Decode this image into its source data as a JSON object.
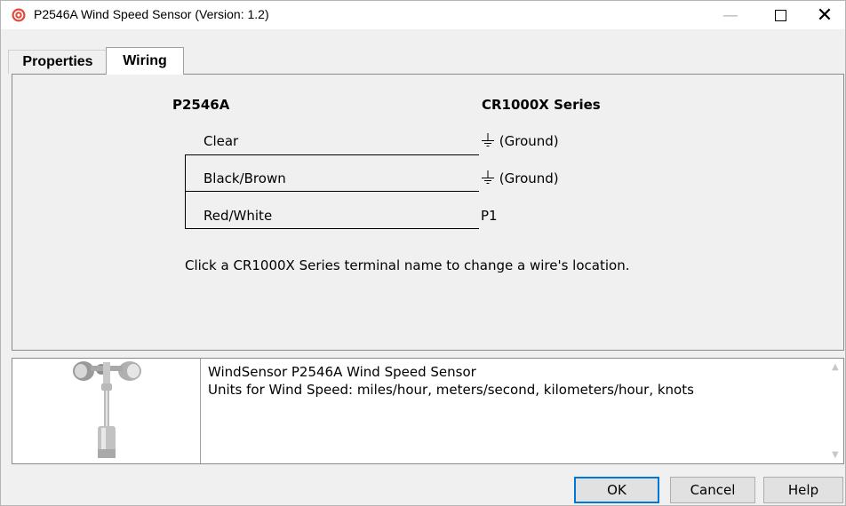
{
  "window": {
    "title": "P2546A Wind Speed Sensor (Version: 1.2)",
    "minimize_symbol": "—",
    "close_symbol": "✕"
  },
  "tabs": [
    {
      "label": "Properties",
      "selected": false
    },
    {
      "label": "Wiring",
      "selected": true
    }
  ],
  "wiring": {
    "sensor_header": "P2546A",
    "logger_header": "CR1000X Series",
    "wires": [
      {
        "name": "Clear",
        "terminal": "(Ground)",
        "terminal_icon": "ground-icon"
      },
      {
        "name": "Black/Brown",
        "terminal": "(Ground)",
        "terminal_icon": "ground-icon"
      },
      {
        "name": "Red/White",
        "terminal": "P1",
        "terminal_icon": ""
      }
    ],
    "hint": "Click a CR1000X Series terminal name to change a wire's location."
  },
  "description": {
    "line1": "WindSensor P2546A Wind Speed Sensor",
    "line2": "Units for Wind Speed: miles/hour, meters/second, kilometers/hour, knots",
    "image_icon": "anemometer-icon"
  },
  "buttons": {
    "ok": "OK",
    "cancel": "Cancel",
    "help": "Help"
  },
  "colors": {
    "app_icon": "#e04b3c",
    "focus_border": "#0078d7",
    "window_bg": "#f0f0f0"
  }
}
